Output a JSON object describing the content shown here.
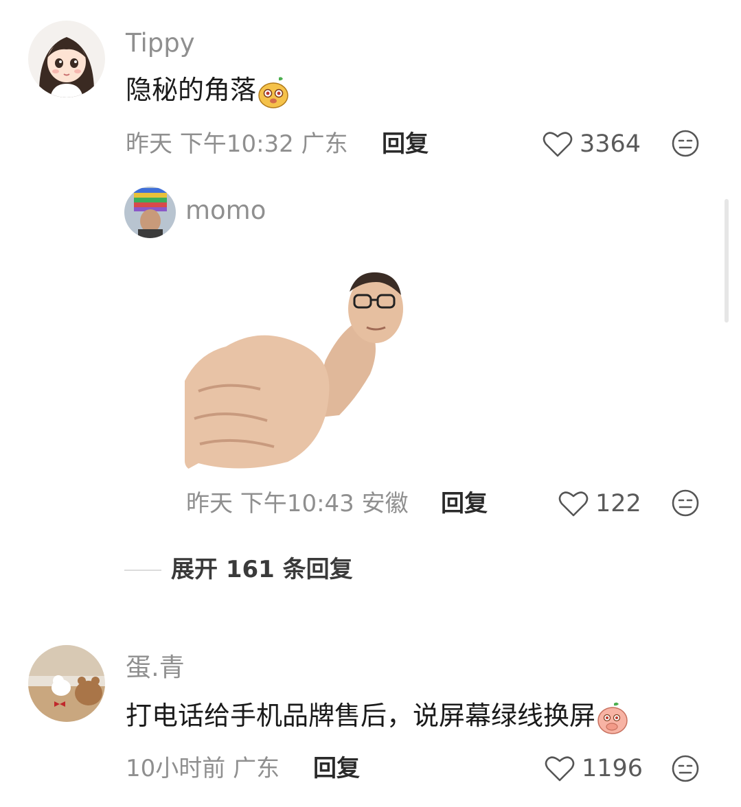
{
  "comments": [
    {
      "user": "Tippy",
      "text": "隐秘的角落",
      "emoji_icon": "yellow-pear-emoji-icon",
      "time": "昨天 下午10:32",
      "location": "广东",
      "reply_label": "回复",
      "likes": "3364",
      "avatar_icon": "girl-cartoon-avatar-icon"
    },
    {
      "user": "蛋.青",
      "text": "打电话给手机品牌售后，说屏幕绿线换屏",
      "emoji_icon": "peach-covering-mouth-emoji-icon",
      "time": "10小时前",
      "location": "广东",
      "reply_label": "回复",
      "likes": "1196",
      "avatar_icon": "dog-and-bear-photo-avatar-icon"
    }
  ],
  "reply": {
    "user": "momo",
    "time": "昨天 下午10:43",
    "location": "安徽",
    "reply_label": "回复",
    "likes": "122",
    "sticker_icon": "thumbs-up-face-sticker-icon",
    "avatar_icon": "rainbow-hat-man-avatar-icon"
  },
  "expand": {
    "label": "展开 161 条回复"
  },
  "colors": {
    "meta_gray": "#8f8f8f",
    "text_dark": "#1a1a1a",
    "background": "#ffffff"
  }
}
